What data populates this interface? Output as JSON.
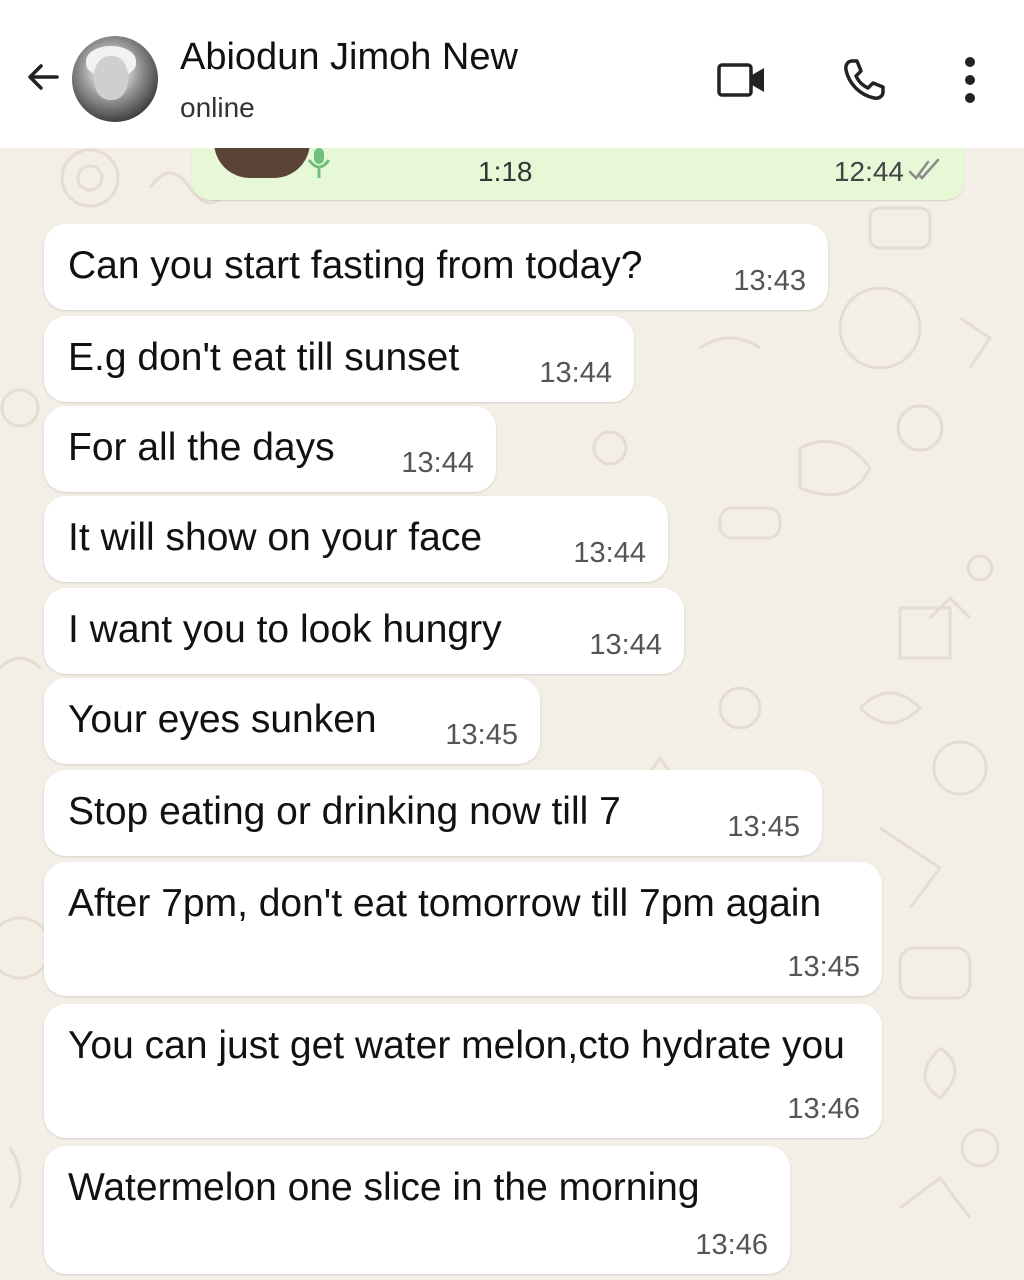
{
  "header": {
    "contact_name": "Abiodun Jimoh New",
    "status": "online",
    "icons": [
      "back-arrow-icon",
      "video-call-icon",
      "phone-icon",
      "more-icon"
    ]
  },
  "voice_note": {
    "duration": "1:18",
    "time": "12:44"
  },
  "messages": [
    {
      "text": "Can you start fasting from today?",
      "time": "13:43"
    },
    {
      "text": "E.g don't eat till sunset",
      "time": "13:44"
    },
    {
      "text": "For all the days",
      "time": "13:44"
    },
    {
      "text": "It will show on your face",
      "time": "13:44"
    },
    {
      "text": "I want you to look hungry",
      "time": "13:44"
    },
    {
      "text": "Your eyes sunken",
      "time": "13:45"
    },
    {
      "text": "Stop eating or drinking now till 7",
      "time": "13:45"
    },
    {
      "text": "After 7pm, don't eat tomorrow till 7pm again",
      "time": "13:45"
    },
    {
      "text": "You can just get water melon,cto hydrate you",
      "time": "13:46"
    },
    {
      "text": "Watermelon one slice in the morning",
      "time": "13:46"
    }
  ],
  "colors": {
    "header_bg": "#ffffff",
    "chat_bg": "#f3eee6",
    "incoming_bubble": "#ffffff",
    "outgoing_bubble": "#e7f8d6"
  }
}
